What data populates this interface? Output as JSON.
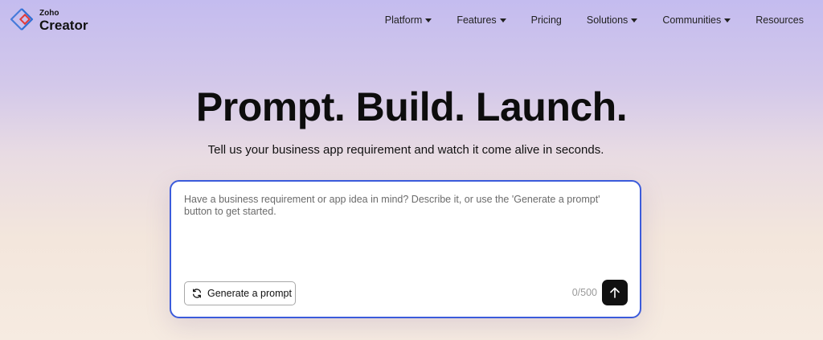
{
  "brand": {
    "small": "Zoho",
    "name": "Creator"
  },
  "nav": {
    "items": [
      {
        "label": "Platform",
        "dropdown": true
      },
      {
        "label": "Features",
        "dropdown": true
      },
      {
        "label": "Pricing",
        "dropdown": false
      },
      {
        "label": "Solutions",
        "dropdown": true
      },
      {
        "label": "Communities",
        "dropdown": true
      },
      {
        "label": "Resources",
        "dropdown": false
      }
    ]
  },
  "hero": {
    "title": "Prompt. Build. Launch.",
    "subtitle": "Tell us your business app requirement and watch it come alive in seconds."
  },
  "prompt": {
    "placeholder": "Have a business requirement or app idea in mind? Describe it, or use the 'Generate a prompt' button to get started.",
    "generate_label": "Generate a prompt",
    "counter": "0/500",
    "send_icon": "arrow-up-icon",
    "generate_icon": "refresh-icon"
  },
  "colors": {
    "accent_border": "#3b5bdb",
    "send_bg": "#111111",
    "logo_blue": "#2f6fd6",
    "logo_red": "#e23b3b"
  }
}
